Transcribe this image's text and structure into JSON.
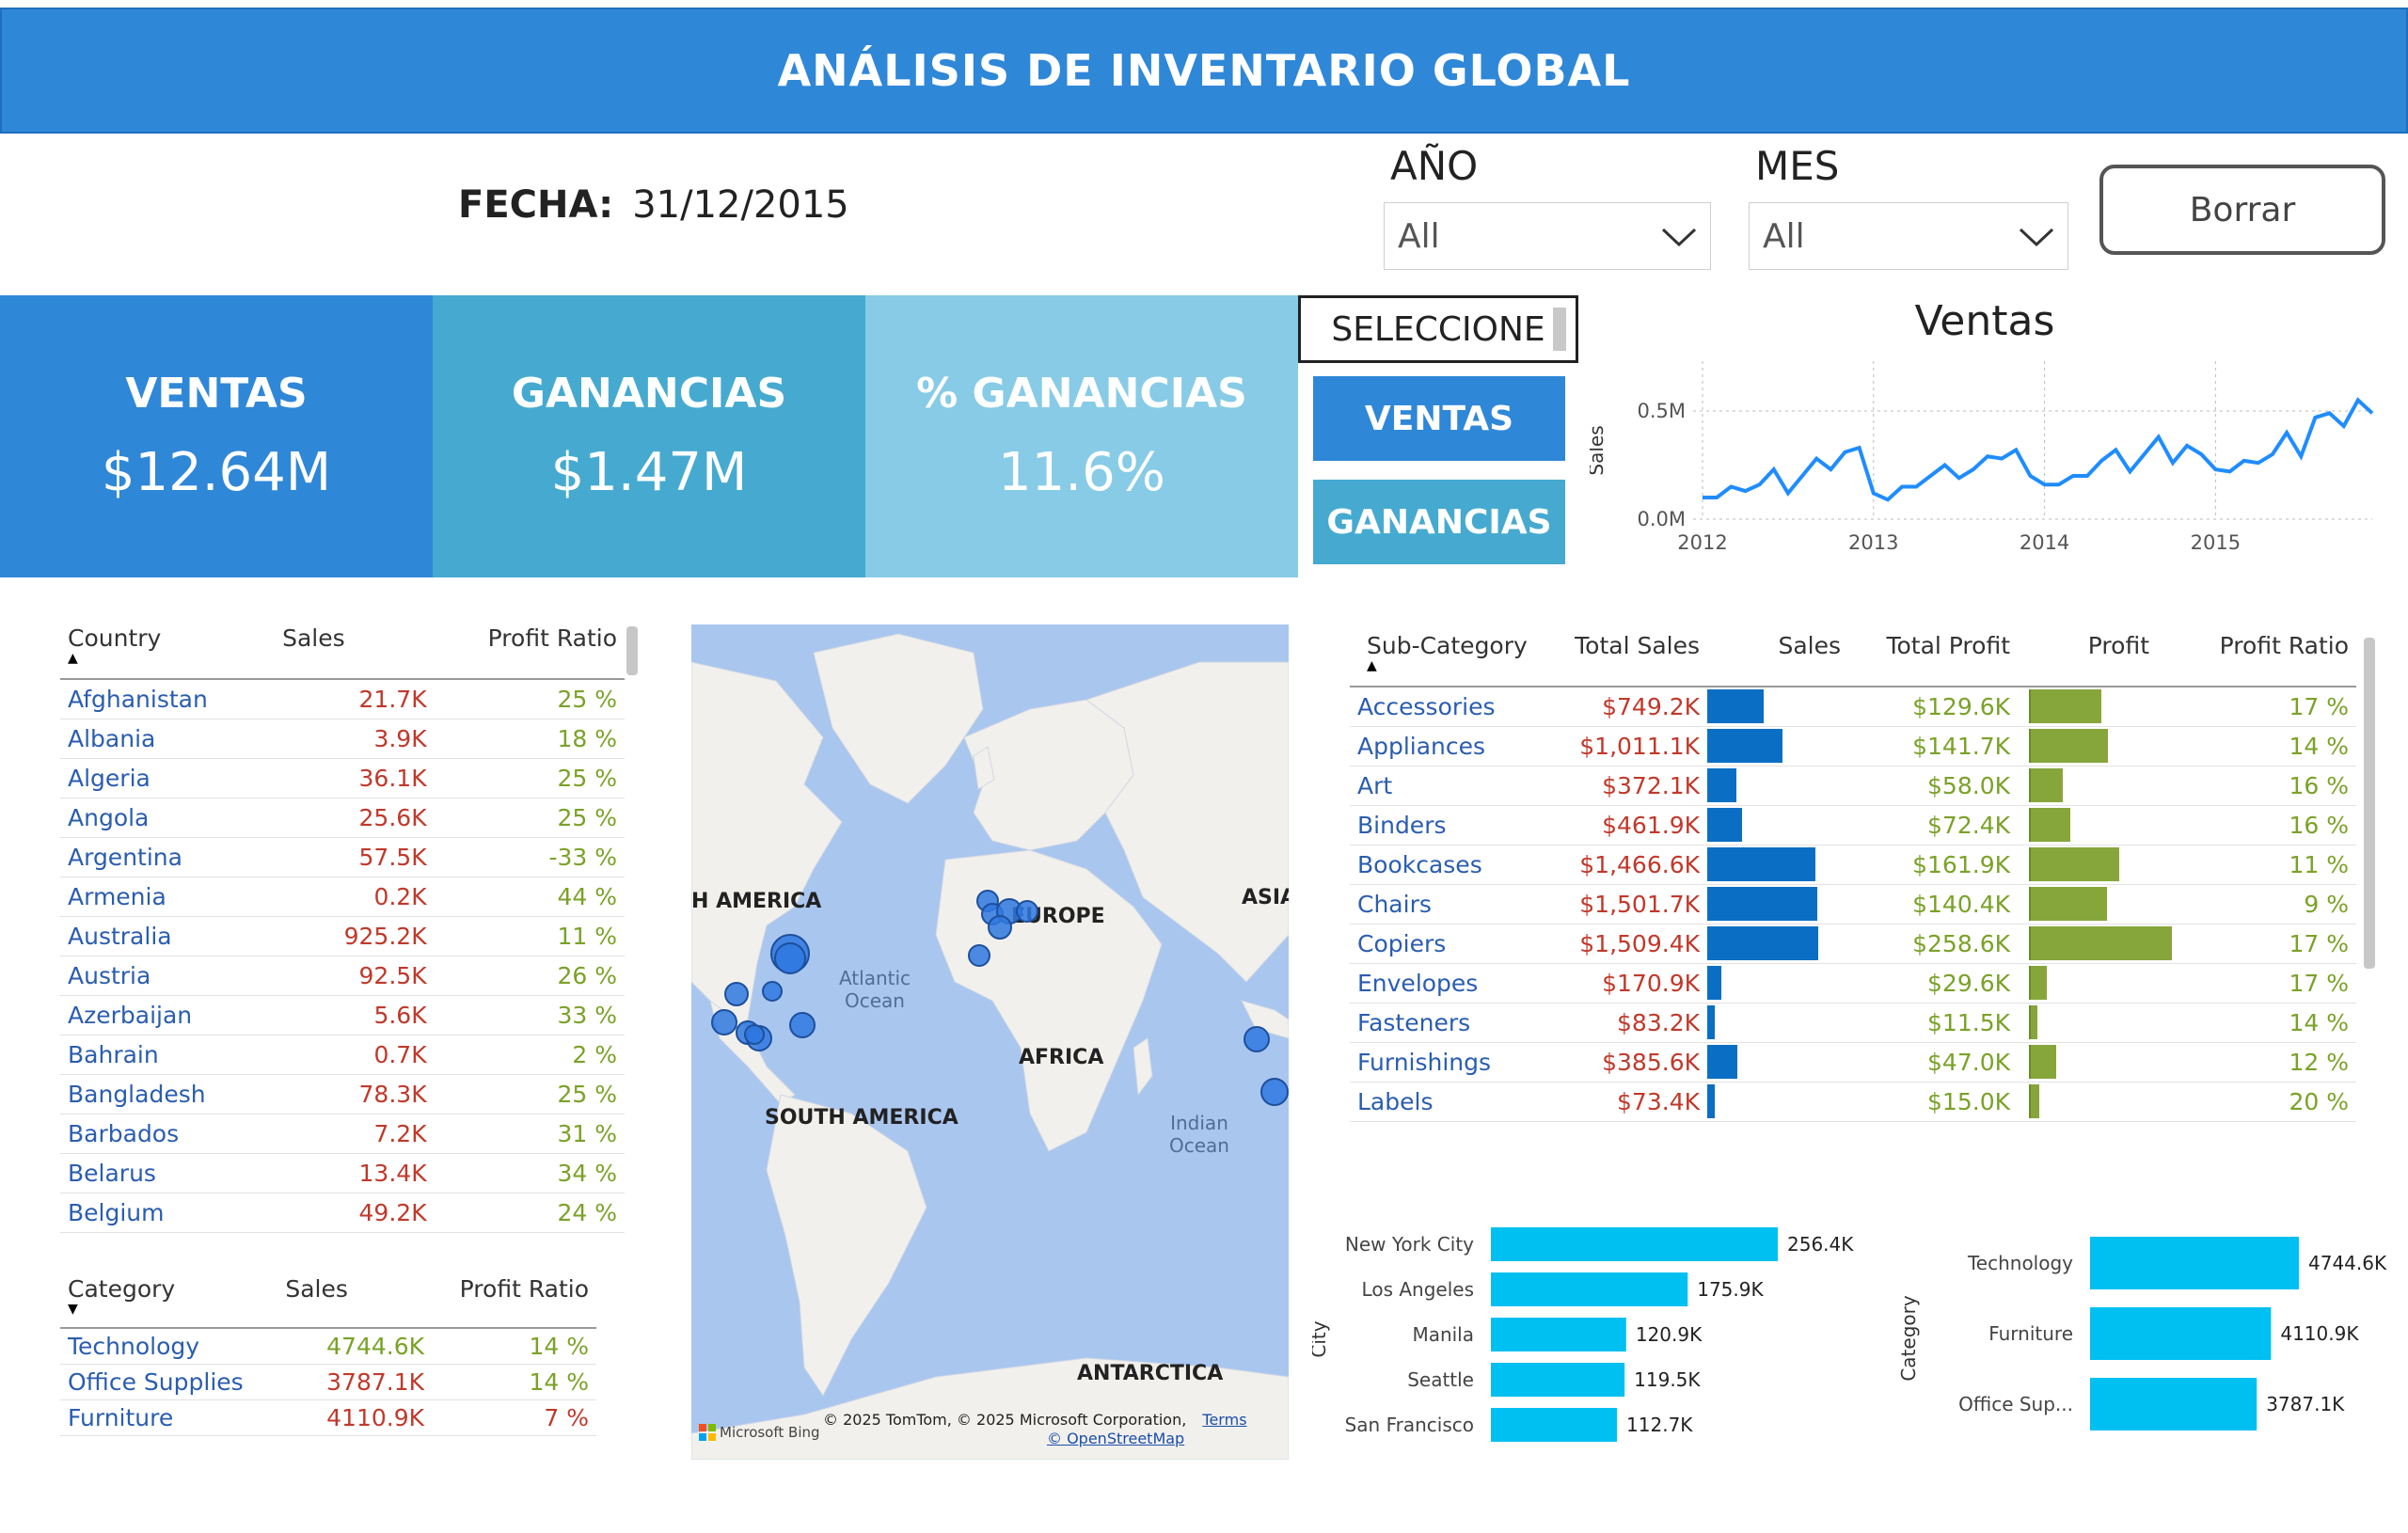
{
  "header": {
    "title": "ANÁLISIS DE INVENTARIO GLOBAL"
  },
  "fecha": {
    "label": "FECHA:",
    "value": "31/12/2015"
  },
  "filters": {
    "year": {
      "label": "AÑO",
      "value": "All"
    },
    "month": {
      "label": "MES",
      "value": "All"
    },
    "clear_label": "Borrar"
  },
  "kpis": [
    {
      "title": "VENTAS",
      "value": "$12.64M",
      "color": "#2f87d8"
    },
    {
      "title": "GANANCIAS",
      "value": "$1.47M",
      "color": "#46aad0"
    },
    {
      "title": "% GANANCIAS",
      "value": "11.6%",
      "color": "#87cbe7"
    }
  ],
  "selector": {
    "label": "SELECCIONE",
    "buttons": [
      {
        "label": "VENTAS",
        "color": "#2f87d8"
      },
      {
        "label": "GANANCIAS",
        "color": "#46aad0"
      }
    ]
  },
  "country_table": {
    "headers": [
      "Country",
      "Sales",
      "Profit Ratio"
    ],
    "rows": [
      [
        "Afghanistan",
        "21.7K",
        "25 %"
      ],
      [
        "Albania",
        "3.9K",
        "18 %"
      ],
      [
        "Algeria",
        "36.1K",
        "25 %"
      ],
      [
        "Angola",
        "25.6K",
        "25 %"
      ],
      [
        "Argentina",
        "57.5K",
        "-33 %"
      ],
      [
        "Armenia",
        "0.2K",
        "44 %"
      ],
      [
        "Australia",
        "925.2K",
        "11 %"
      ],
      [
        "Austria",
        "92.5K",
        "26 %"
      ],
      [
        "Azerbaijan",
        "5.6K",
        "33 %"
      ],
      [
        "Bahrain",
        "0.7K",
        "2 %"
      ],
      [
        "Bangladesh",
        "78.3K",
        "25 %"
      ],
      [
        "Barbados",
        "7.2K",
        "31 %"
      ],
      [
        "Belarus",
        "13.4K",
        "34 %"
      ],
      [
        "Belgium",
        "49.2K",
        "24 %"
      ]
    ]
  },
  "category_table": {
    "headers": [
      "Category",
      "Sales",
      "Profit Ratio"
    ],
    "rows": [
      [
        "Technology",
        "4744.6K",
        "14 %"
      ],
      [
        "Office Supplies",
        "3787.1K",
        "14 %"
      ],
      [
        "Furniture",
        "4110.9K",
        "7 %"
      ]
    ]
  },
  "map": {
    "labels": [
      "H AMERICA",
      "EUROPE",
      "ASIA",
      "AFRICA",
      "SOUTH AMERICA",
      "ANTARCTICA"
    ],
    "oceans": [
      "Atlantic Ocean",
      "Indian Ocean"
    ],
    "attribution": "© 2025 TomTom, © 2025 Microsoft Corporation,",
    "terms": "Terms",
    "osm": "© OpenStreetMap",
    "bing": "Microsoft Bing",
    "marker_color": "#2f78e0"
  },
  "subcategory_table": {
    "headers": [
      "Sub-Category",
      "Total Sales",
      "Sales",
      "Total Profit",
      "Profit",
      "Profit Ratio"
    ],
    "rows": [
      {
        "name": "Accessories",
        "total_sales": "$749.2K",
        "sales": 749.2,
        "total_profit": "$129.6K",
        "profit": 129.6,
        "ratio": "17 %"
      },
      {
        "name": "Appliances",
        "total_sales": "$1,011.1K",
        "sales": 1011.1,
        "total_profit": "$141.7K",
        "profit": 141.7,
        "ratio": "14 %"
      },
      {
        "name": "Art",
        "total_sales": "$372.1K",
        "sales": 372.1,
        "total_profit": "$58.0K",
        "profit": 58.0,
        "ratio": "16 %"
      },
      {
        "name": "Binders",
        "total_sales": "$461.9K",
        "sales": 461.9,
        "total_profit": "$72.4K",
        "profit": 72.4,
        "ratio": "16 %"
      },
      {
        "name": "Bookcases",
        "total_sales": "$1,466.6K",
        "sales": 1466.6,
        "total_profit": "$161.9K",
        "profit": 161.9,
        "ratio": "11 %"
      },
      {
        "name": "Chairs",
        "total_sales": "$1,501.7K",
        "sales": 1501.7,
        "total_profit": "$140.4K",
        "profit": 140.4,
        "ratio": "9 %"
      },
      {
        "name": "Copiers",
        "total_sales": "$1,509.4K",
        "sales": 1509.4,
        "total_profit": "$258.6K",
        "profit": 258.6,
        "ratio": "17 %"
      },
      {
        "name": "Envelopes",
        "total_sales": "$170.9K",
        "sales": 170.9,
        "total_profit": "$29.6K",
        "profit": 29.6,
        "ratio": "17 %"
      },
      {
        "name": "Fasteners",
        "total_sales": "$83.2K",
        "sales": 83.2,
        "total_profit": "$11.5K",
        "profit": 11.5,
        "ratio": "14 %"
      },
      {
        "name": "Furnishings",
        "total_sales": "$385.6K",
        "sales": 385.6,
        "total_profit": "$47.0K",
        "profit": 47.0,
        "ratio": "12 %"
      },
      {
        "name": "Labels",
        "total_sales": "$73.4K",
        "sales": 73.4,
        "total_profit": "$15.0K",
        "profit": 15.0,
        "ratio": "20 %"
      }
    ],
    "sales_bar_color": "#0a6fc4",
    "profit_bar_color": "#86a63c"
  },
  "chart_data": [
    {
      "type": "line",
      "title": "Ventas",
      "ylabel": "Sales",
      "xlabel": "",
      "x_ticks": [
        "2012",
        "2013",
        "2014",
        "2015"
      ],
      "y_ticks": [
        "0.0M",
        "0.5M"
      ],
      "ylim": [
        0,
        0.6
      ],
      "x": [
        "2012-01",
        "2012-02",
        "2012-03",
        "2012-04",
        "2012-05",
        "2012-06",
        "2012-07",
        "2012-08",
        "2012-09",
        "2012-10",
        "2012-11",
        "2012-12",
        "2013-01",
        "2013-02",
        "2013-03",
        "2013-04",
        "2013-05",
        "2013-06",
        "2013-07",
        "2013-08",
        "2013-09",
        "2013-10",
        "2013-11",
        "2013-12",
        "2014-01",
        "2014-02",
        "2014-03",
        "2014-04",
        "2014-05",
        "2014-06",
        "2014-07",
        "2014-08",
        "2014-09",
        "2014-10",
        "2014-11",
        "2014-12",
        "2015-01",
        "2015-02",
        "2015-03",
        "2015-04",
        "2015-05",
        "2015-06",
        "2015-07",
        "2015-08",
        "2015-09",
        "2015-10",
        "2015-11",
        "2015-12"
      ],
      "values": [
        0.1,
        0.1,
        0.15,
        0.13,
        0.16,
        0.23,
        0.12,
        0.2,
        0.28,
        0.23,
        0.31,
        0.33,
        0.12,
        0.09,
        0.15,
        0.15,
        0.2,
        0.25,
        0.19,
        0.23,
        0.29,
        0.28,
        0.32,
        0.2,
        0.16,
        0.16,
        0.2,
        0.2,
        0.27,
        0.32,
        0.22,
        0.3,
        0.38,
        0.26,
        0.34,
        0.3,
        0.23,
        0.22,
        0.27,
        0.26,
        0.3,
        0.4,
        0.29,
        0.47,
        0.49,
        0.43,
        0.55,
        0.49
      ],
      "color": "#1f8cff"
    },
    {
      "type": "bar",
      "orientation": "horizontal",
      "ylabel": "City",
      "categories": [
        "New York City",
        "Los Angeles",
        "Manila",
        "Seattle",
        "San Francisco"
      ],
      "values": [
        256.4,
        175.9,
        120.9,
        119.5,
        112.7
      ],
      "labels": [
        "256.4K",
        "175.9K",
        "120.9K",
        "119.5K",
        "112.7K"
      ],
      "color": "#00c0f2"
    },
    {
      "type": "bar",
      "orientation": "horizontal",
      "ylabel": "Category",
      "categories": [
        "Technology",
        "Furniture",
        "Office Sup..."
      ],
      "values": [
        4744.6,
        4110.9,
        3787.1
      ],
      "labels": [
        "4744.6K",
        "4110.9K",
        "3787.1K"
      ],
      "color": "#00c0f2"
    }
  ]
}
